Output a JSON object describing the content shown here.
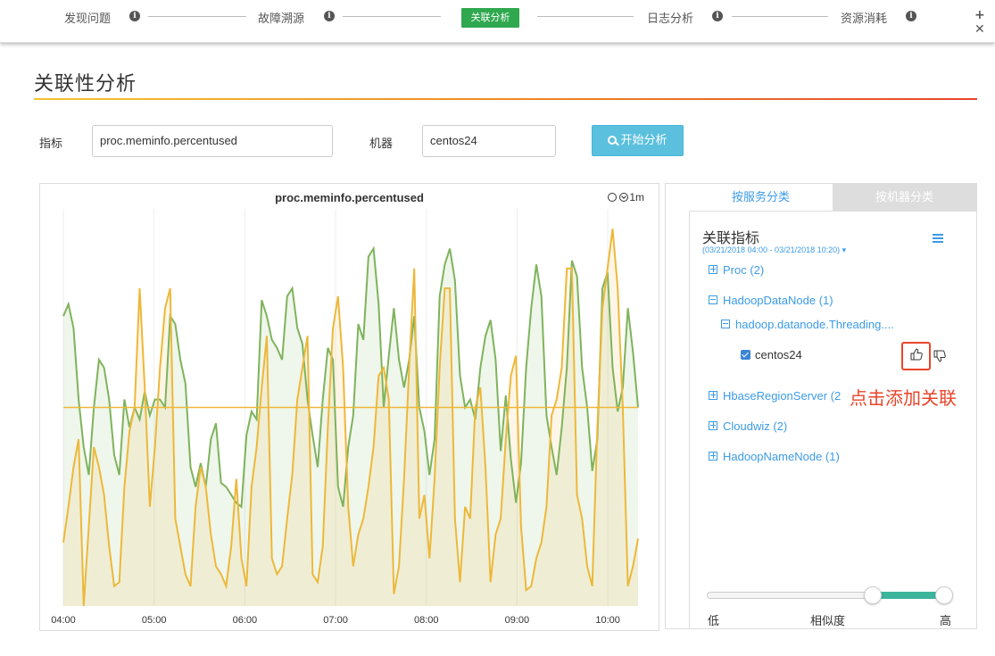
{
  "steps": [
    {
      "label": "发现问题"
    },
    {
      "label": "故障溯源"
    },
    {
      "label": "关联分析"
    },
    {
      "label": "日志分析"
    },
    {
      "label": "资源消耗"
    }
  ],
  "page_title": "关联性分析",
  "form": {
    "metric_label": "指标",
    "metric_value": "proc.meminfo.percentused",
    "machine_label": "机器",
    "machine_value": "centos24",
    "analyze_button": "开始分析"
  },
  "chart_data": {
    "type": "line",
    "title": "proc.meminfo.percentused",
    "time_window": "1m",
    "x_ticks": [
      "04:00",
      "05:00",
      "06:00",
      "07:00",
      "08:00",
      "09:00",
      "10:00"
    ],
    "x_range": [
      "04:00",
      "10:20"
    ],
    "baseline_value": 0.5,
    "series": [
      {
        "color": "#7fb35c",
        "values": [
          0.73,
          0.76,
          0.7,
          0.52,
          0.4,
          0.33,
          0.5,
          0.62,
          0.6,
          0.52,
          0.38,
          0.33,
          0.52,
          0.45,
          0.5,
          0.47,
          0.54,
          0.48,
          0.52,
          0.52,
          0.5,
          0.73,
          0.71,
          0.62,
          0.56,
          0.35,
          0.3,
          0.36,
          0.3,
          0.42,
          0.46,
          0.31,
          0.3,
          0.28,
          0.26,
          0.25,
          0.43,
          0.49,
          0.47,
          0.77,
          0.73,
          0.67,
          0.65,
          0.62,
          0.78,
          0.8,
          0.7,
          0.66,
          0.52,
          0.43,
          0.35,
          0.52,
          0.65,
          0.62,
          0.3,
          0.25,
          0.4,
          0.48,
          0.71,
          0.67,
          0.88,
          0.9,
          0.76,
          0.5,
          0.63,
          0.75,
          0.62,
          0.55,
          0.62,
          0.73,
          0.5,
          0.44,
          0.33,
          0.42,
          0.78,
          0.86,
          0.9,
          0.82,
          0.58,
          0.5,
          0.52,
          0.47,
          0.6,
          0.68,
          0.72,
          0.62,
          0.39,
          0.53,
          0.37,
          0.26,
          0.36,
          0.6,
          0.75,
          0.86,
          0.78,
          0.48,
          0.4,
          0.33,
          0.45,
          0.6,
          0.87,
          0.83,
          0.6,
          0.5,
          0.34,
          0.42,
          0.8,
          0.84,
          0.6,
          0.49,
          0.55,
          0.75,
          0.64,
          0.5
        ]
      },
      {
        "color": "#edb83a",
        "values": [
          0.16,
          0.25,
          0.35,
          0.42,
          0.0,
          0.2,
          0.4,
          0.35,
          0.28,
          0.15,
          0.05,
          0.06,
          0.3,
          0.44,
          0.5,
          0.8,
          0.55,
          0.25,
          0.4,
          0.6,
          0.75,
          0.8,
          0.22,
          0.15,
          0.08,
          0.05,
          0.25,
          0.35,
          0.3,
          0.18,
          0.1,
          0.08,
          0.05,
          0.15,
          0.32,
          0.12,
          0.05,
          0.3,
          0.4,
          0.55,
          0.68,
          0.12,
          0.08,
          0.1,
          0.22,
          0.33,
          0.52,
          0.6,
          0.68,
          0.08,
          0.06,
          0.15,
          0.45,
          0.7,
          0.78,
          0.6,
          0.25,
          0.1,
          0.18,
          0.22,
          0.3,
          0.4,
          0.58,
          0.6,
          0.52,
          0.03,
          0.1,
          0.32,
          0.6,
          0.85,
          0.22,
          0.28,
          0.12,
          0.32,
          0.6,
          0.8,
          0.8,
          0.22,
          0.06,
          0.25,
          0.22,
          0.5,
          0.55,
          0.35,
          0.06,
          0.18,
          0.22,
          0.42,
          0.58,
          0.63,
          0.2,
          0.04,
          0.05,
          0.12,
          0.16,
          0.25,
          0.48,
          0.52,
          0.6,
          0.85,
          0.85,
          0.28,
          0.22,
          0.1,
          0.05,
          0.45,
          0.75,
          0.85,
          0.95,
          0.8,
          0.5,
          0.05,
          0.1,
          0.17
        ]
      }
    ]
  },
  "tabs": [
    {
      "label": "按服务分类",
      "active": true
    },
    {
      "label": "按机器分类",
      "active": false
    }
  ],
  "related": {
    "title": "关联指标",
    "range": "(03/21/2018 04:00 - 03/21/2018 10:20) ▾",
    "tree": [
      {
        "label": "Proc (2)",
        "expanded": false
      },
      {
        "label": "HadoopDataNode (1)",
        "expanded": true
      },
      {
        "label": "hadoop.datanode.Threading....",
        "expanded": true
      },
      {
        "label": "centos24",
        "checked": true
      },
      {
        "label": "HbaseRegionServer (2",
        "expanded": false
      },
      {
        "label": "Cloudwiz (2)",
        "expanded": false
      },
      {
        "label": "HadoopNameNode (1)",
        "expanded": false
      }
    ]
  },
  "annotation": "点击添加关联",
  "slider": {
    "low_label": "低",
    "mid_label": "相似度",
    "high_label": "高",
    "range_low": 0.7,
    "range_high": 1.0,
    "accent": "#3bb59c"
  },
  "colors": {
    "active_step": "#2fa84f",
    "link": "#3c9be5",
    "highlight": "#e8442a"
  }
}
